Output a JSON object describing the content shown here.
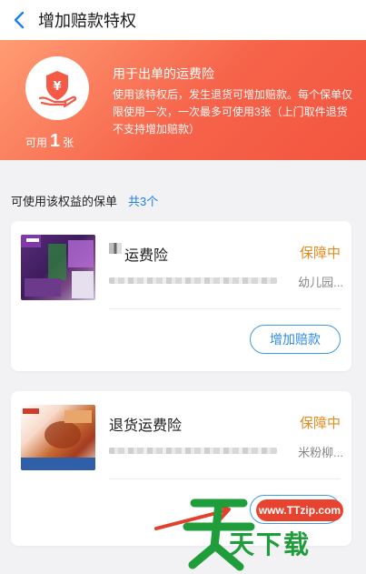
{
  "header": {
    "title": "增加赔款特权"
  },
  "hero": {
    "count_prefix": "可用",
    "count_num": "1",
    "count_unit": "张",
    "heading": "用于出单的运费险",
    "description": "使用该特权后，发生退货可增加赔款。每个保单仅限使用一次，一次最多可使用3张（上门取件退货不支持增加赔款）"
  },
  "list": {
    "label": "可使用该权益的保单",
    "count": "共3个"
  },
  "policies": [
    {
      "name": "运费险",
      "status": "保障中",
      "address_tail": "幼儿园...",
      "action": "增加赔款"
    },
    {
      "name": "退货运费险",
      "status": "保障中",
      "address_tail": "米粉柳...",
      "action": "增加赔款"
    }
  ],
  "watermark": {
    "site": "www.TTzip.com",
    "brand": "天下载"
  },
  "colors": {
    "accent": "#f3553f",
    "link": "#1b7ff0",
    "status": "#e58a1f",
    "watermark_green": "#1f9d3a"
  }
}
